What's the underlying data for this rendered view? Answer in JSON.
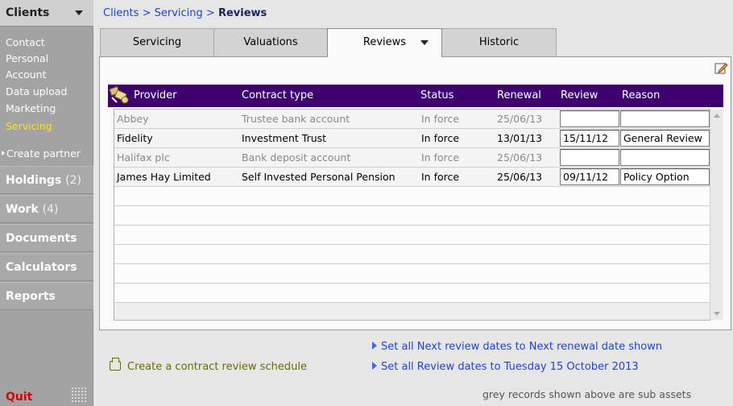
{
  "sidebar": {
    "header": "Clients",
    "sub_items": [
      "Contact",
      "Personal",
      "Account",
      "Data upload",
      "Marketing",
      "Servicing"
    ],
    "active_item": "Servicing",
    "create_partner": "Create partner",
    "sections": [
      {
        "label": "Holdings",
        "count": "(2)"
      },
      {
        "label": "Work",
        "count": "(4)"
      },
      {
        "label": "Documents",
        "count": ""
      },
      {
        "label": "Calculators",
        "count": ""
      },
      {
        "label": "Reports",
        "count": ""
      }
    ],
    "quit": "Quit"
  },
  "breadcrumb": {
    "clients": "Clients",
    "sep1": ">",
    "servicing": "Servicing",
    "sep2": ">",
    "current": "Reviews"
  },
  "tabs": [
    "Servicing",
    "Valuations",
    "Reviews",
    "Historic"
  ],
  "active_tab": "Reviews",
  "table": {
    "headers": [
      "Provider",
      "Contract type",
      "Status",
      "Renewal",
      "Review",
      "Reason"
    ],
    "rows": [
      {
        "provider": "Abbey",
        "contract_type": "Trustee bank account",
        "status": "In force",
        "renewal": "25/06/13",
        "review": "",
        "reason": "",
        "sub_asset": true
      },
      {
        "provider": "Fidelity",
        "contract_type": "Investment Trust",
        "status": "In force",
        "renewal": "13/01/13",
        "review": "15/11/12",
        "reason": "General Review",
        "sub_asset": false
      },
      {
        "provider": "Halifax plc",
        "contract_type": "Bank deposit account",
        "status": "In force",
        "renewal": "25/06/13",
        "review": "",
        "reason": "",
        "sub_asset": true
      },
      {
        "provider": "James Hay Limited",
        "contract_type": "Self Invested Personal Pension",
        "status": "In force",
        "renewal": "25/06/13",
        "review": "09/11/12",
        "reason": "Policy Option",
        "sub_asset": false
      }
    ]
  },
  "actions": {
    "create_schedule": "Create a contract review schedule",
    "set_next_review": "Set all Next review dates to Next renewal date shown",
    "set_review_dates": "Set all Review dates to Tuesday 15 October 2013"
  },
  "note": "grey records shown above are sub assets",
  "colors": {
    "header_bg": "#3e006e",
    "link": "#1f45c8",
    "active_sidebar": "#ffdd22",
    "quit": "#d00000",
    "sub_asset_text": "#8a8a8a"
  }
}
